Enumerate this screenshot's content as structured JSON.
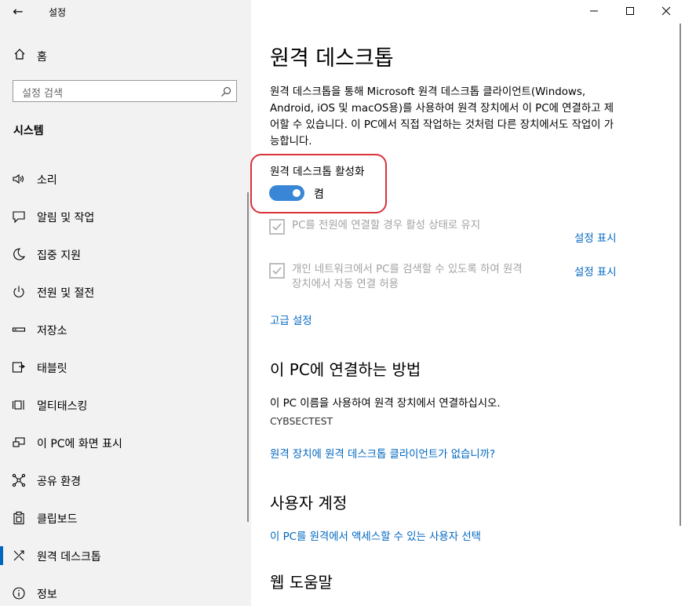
{
  "window": {
    "title": "설정"
  },
  "sidebar": {
    "home_label": "홈",
    "search_placeholder": "설정 검색",
    "section_title": "시스템",
    "items": [
      {
        "label": "소리",
        "icon": "speaker-icon"
      },
      {
        "label": "알림 및 작업",
        "icon": "notification-icon"
      },
      {
        "label": "집중 지원",
        "icon": "moon-icon"
      },
      {
        "label": "전원 및 절전",
        "icon": "power-icon"
      },
      {
        "label": "저장소",
        "icon": "storage-icon"
      },
      {
        "label": "태블릿",
        "icon": "tablet-icon"
      },
      {
        "label": "멀티태스킹",
        "icon": "multitask-icon"
      },
      {
        "label": "이 PC에 화면 표시",
        "icon": "project-icon"
      },
      {
        "label": "공유 환경",
        "icon": "share-icon"
      },
      {
        "label": "클립보드",
        "icon": "clipboard-icon"
      },
      {
        "label": "원격 데스크톱",
        "icon": "remote-desktop-icon",
        "active": true
      },
      {
        "label": "정보",
        "icon": "info-icon"
      }
    ]
  },
  "main": {
    "title": "원격 데스크톱",
    "description": "원격 데스크톱을 통해 Microsoft 원격 데스크톱 클라이언트(Windows, Android, iOS 및 macOS용)를 사용하여 원격 장치에서 이 PC에 연결하고 제어할 수 있습니다. 이 PC에서 직접 작업하는 것처럼 다른 장치에서도 작업이 가능합니다.",
    "toggle_label": "원격 데스크톱 활성화",
    "toggle_state": "켬",
    "toggle_on": true,
    "checkbox1_label": "PC를 전원에 연결할 경우 활성 상태로 유지",
    "checkbox2_line1": "개인 네트워크에서 PC를 검색할 수 있도록 하여 원격",
    "checkbox2_line2": "장치에서 자동 연결 허용",
    "show_settings_1": "설정 표시",
    "show_settings_2": "설정 표시",
    "advanced_link": "고급 설정",
    "connect_heading": "이 PC에 연결하는 방법",
    "connect_text": "이 PC 이름을 사용하여 원격 장치에서 연결하십시오.",
    "pc_name": "CYBSECTEST",
    "no_client_link": "원격 장치에 원격 데스크톱 클라이언트가 없습니까?",
    "accounts_heading": "사용자 계정",
    "accounts_link": "이 PC를 원격에서 액세스할 수 있는 사용자 선택",
    "help_heading": "웹 도움말"
  },
  "colors": {
    "accent": "#0067c0",
    "toggle": "#3a86d6",
    "highlight": "#d9333a"
  }
}
